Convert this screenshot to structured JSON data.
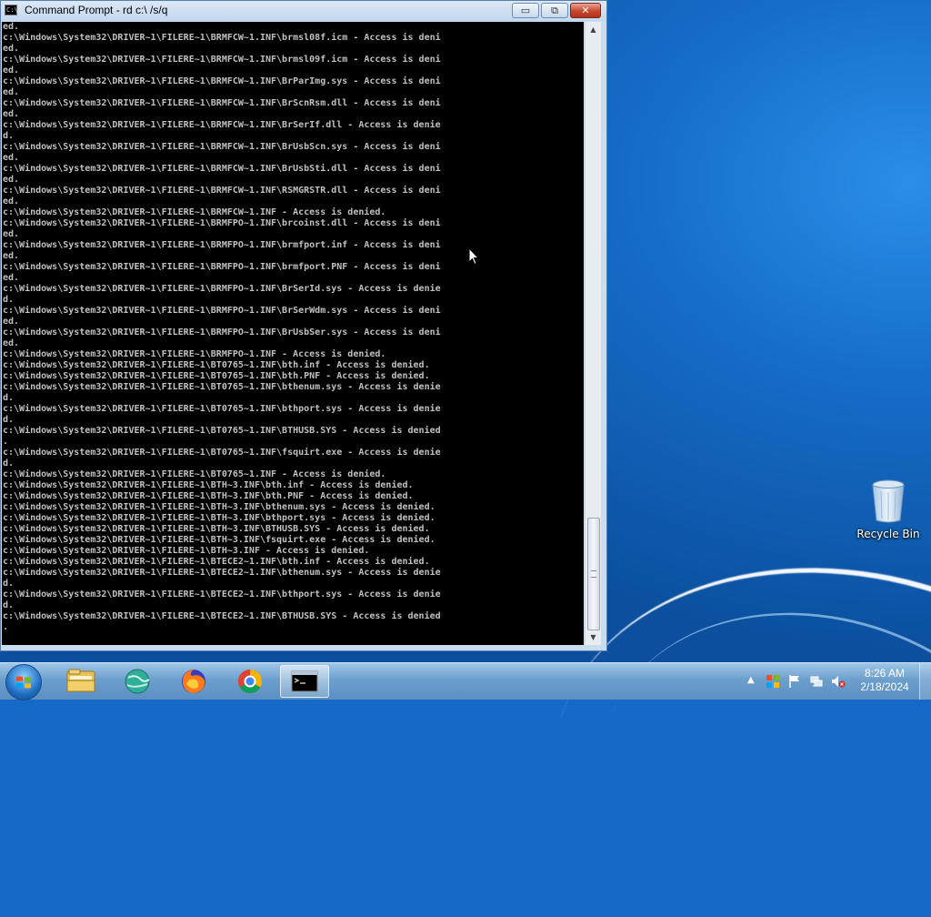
{
  "window": {
    "title": "Command Prompt - rd  c:\\ /s/q",
    "minimize_glyph": "▭",
    "maximize_glyph": "⧉",
    "close_glyph": "✕",
    "icon_text": "C:\\"
  },
  "console": {
    "lines": [
      "ed.",
      "c:\\Windows\\System32\\DRIVER~1\\FILERE~1\\BRMFCW~1.INF\\brmsl08f.icm - Access is deni",
      "ed.",
      "c:\\Windows\\System32\\DRIVER~1\\FILERE~1\\BRMFCW~1.INF\\brmsl09f.icm - Access is deni",
      "ed.",
      "c:\\Windows\\System32\\DRIVER~1\\FILERE~1\\BRMFCW~1.INF\\BrParImg.sys - Access is deni",
      "ed.",
      "c:\\Windows\\System32\\DRIVER~1\\FILERE~1\\BRMFCW~1.INF\\BrScnRsm.dll - Access is deni",
      "ed.",
      "c:\\Windows\\System32\\DRIVER~1\\FILERE~1\\BRMFCW~1.INF\\BrSerIf.dll - Access is denie",
      "d.",
      "c:\\Windows\\System32\\DRIVER~1\\FILERE~1\\BRMFCW~1.INF\\BrUsbScn.sys - Access is deni",
      "ed.",
      "c:\\Windows\\System32\\DRIVER~1\\FILERE~1\\BRMFCW~1.INF\\BrUsbSti.dll - Access is deni",
      "ed.",
      "c:\\Windows\\System32\\DRIVER~1\\FILERE~1\\BRMFCW~1.INF\\RSMGRSTR.dll - Access is deni",
      "ed.",
      "c:\\Windows\\System32\\DRIVER~1\\FILERE~1\\BRMFCW~1.INF - Access is denied.",
      "c:\\Windows\\System32\\DRIVER~1\\FILERE~1\\BRMFPO~1.INF\\brcoinst.dll - Access is deni",
      "ed.",
      "c:\\Windows\\System32\\DRIVER~1\\FILERE~1\\BRMFPO~1.INF\\brmfport.inf - Access is deni",
      "ed.",
      "c:\\Windows\\System32\\DRIVER~1\\FILERE~1\\BRMFPO~1.INF\\brmfport.PNF - Access is deni",
      "ed.",
      "c:\\Windows\\System32\\DRIVER~1\\FILERE~1\\BRMFPO~1.INF\\BrSerId.sys - Access is denie",
      "d.",
      "c:\\Windows\\System32\\DRIVER~1\\FILERE~1\\BRMFPO~1.INF\\BrSerWdm.sys - Access is deni",
      "ed.",
      "c:\\Windows\\System32\\DRIVER~1\\FILERE~1\\BRMFPO~1.INF\\BrUsbSer.sys - Access is deni",
      "ed.",
      "c:\\Windows\\System32\\DRIVER~1\\FILERE~1\\BRMFPO~1.INF - Access is denied.",
      "c:\\Windows\\System32\\DRIVER~1\\FILERE~1\\BT0765~1.INF\\bth.inf - Access is denied.",
      "c:\\Windows\\System32\\DRIVER~1\\FILERE~1\\BT0765~1.INF\\bth.PNF - Access is denied.",
      "c:\\Windows\\System32\\DRIVER~1\\FILERE~1\\BT0765~1.INF\\bthenum.sys - Access is denie",
      "d.",
      "c:\\Windows\\System32\\DRIVER~1\\FILERE~1\\BT0765~1.INF\\bthport.sys - Access is denie",
      "d.",
      "c:\\Windows\\System32\\DRIVER~1\\FILERE~1\\BT0765~1.INF\\BTHUSB.SYS - Access is denied",
      ".",
      "c:\\Windows\\System32\\DRIVER~1\\FILERE~1\\BT0765~1.INF\\fsquirt.exe - Access is denie",
      "d.",
      "c:\\Windows\\System32\\DRIVER~1\\FILERE~1\\BT0765~1.INF - Access is denied.",
      "c:\\Windows\\System32\\DRIVER~1\\FILERE~1\\BTH~3.INF\\bth.inf - Access is denied.",
      "c:\\Windows\\System32\\DRIVER~1\\FILERE~1\\BTH~3.INF\\bth.PNF - Access is denied.",
      "c:\\Windows\\System32\\DRIVER~1\\FILERE~1\\BTH~3.INF\\bthenum.sys - Access is denied.",
      "c:\\Windows\\System32\\DRIVER~1\\FILERE~1\\BTH~3.INF\\bthport.sys - Access is denied.",
      "c:\\Windows\\System32\\DRIVER~1\\FILERE~1\\BTH~3.INF\\BTHUSB.SYS - Access is denied.",
      "c:\\Windows\\System32\\DRIVER~1\\FILERE~1\\BTH~3.INF\\fsquirt.exe - Access is denied.",
      "c:\\Windows\\System32\\DRIVER~1\\FILERE~1\\BTH~3.INF - Access is denied.",
      "c:\\Windows\\System32\\DRIVER~1\\FILERE~1\\BTECE2~1.INF\\bth.inf - Access is denied.",
      "c:\\Windows\\System32\\DRIVER~1\\FILERE~1\\BTECE2~1.INF\\bthenum.sys - Access is denie",
      "d.",
      "c:\\Windows\\System32\\DRIVER~1\\FILERE~1\\BTECE2~1.INF\\bthport.sys - Access is denie",
      "d.",
      "c:\\Windows\\System32\\DRIVER~1\\FILERE~1\\BTECE2~1.INF\\BTHUSB.SYS - Access is denied",
      "."
    ],
    "text_color": "#c0c0c0",
    "background_color": "#000000"
  },
  "desktop": {
    "icons": [
      {
        "label": "Recycle Bin",
        "icon": "recycle-bin-icon"
      }
    ]
  },
  "taskbar": {
    "pinned": [
      {
        "name": "windows-explorer",
        "icon": "folder-icon"
      },
      {
        "name": "app-green-globe",
        "icon": "globe-icon"
      },
      {
        "name": "firefox",
        "icon": "firefox-icon"
      },
      {
        "name": "chrome",
        "icon": "chrome-icon"
      },
      {
        "name": "command-prompt",
        "icon": "cmd-icon",
        "active": true
      }
    ],
    "tray_expand_glyph": "▲",
    "clock": {
      "time": "8:26 AM",
      "date": "2/18/2024"
    }
  }
}
